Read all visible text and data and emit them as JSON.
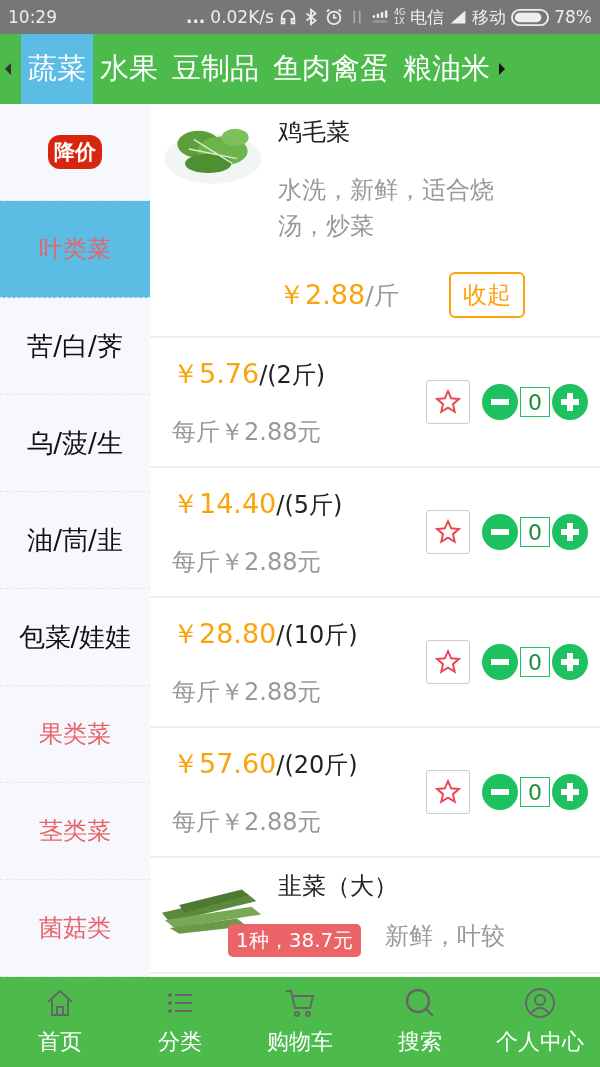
{
  "status_bar": {
    "time": "10:29",
    "dots": "...",
    "speed": "0.02K/s",
    "net_top": "4G",
    "net_bottom": "1X",
    "carrier_1": "电信",
    "carrier_2": "移动",
    "battery": "78%"
  },
  "category_tabs": [
    {
      "label": "蔬菜",
      "selected": true
    },
    {
      "label": "水果",
      "selected": false
    },
    {
      "label": "豆制品",
      "selected": false
    },
    {
      "label": "鱼肉禽蛋",
      "selected": false
    },
    {
      "label": "粮油米",
      "selected": false
    }
  ],
  "sidebar": {
    "items": [
      {
        "label": "降价",
        "kind": "badge",
        "selected": false
      },
      {
        "label": "叶类菜",
        "kind": "category",
        "selected": true
      },
      {
        "label": "苦/白/荠",
        "kind": "sub",
        "selected": false
      },
      {
        "label": "乌/菠/生",
        "kind": "sub",
        "selected": false
      },
      {
        "label": "油/茼/韭",
        "kind": "sub",
        "selected": false
      },
      {
        "label": "包菜/娃娃",
        "kind": "sub",
        "selected": false
      },
      {
        "label": "果类菜",
        "kind": "category",
        "selected": false
      },
      {
        "label": "茎类菜",
        "kind": "category",
        "selected": false
      },
      {
        "label": "菌菇类",
        "kind": "category",
        "selected": false
      }
    ]
  },
  "products": [
    {
      "name": "鸡毛菜",
      "kind": "picture",
      "description": "水洗，新鲜，适合烧汤，炒菜",
      "price": "￥2.88",
      "unit": "/斤",
      "toggle": "收起",
      "expanded": true,
      "variants": [
        {
          "price": "￥5.76",
          "pack": "/(2斤)",
          "per_unit": "每斤￥2.88元",
          "favorite": false,
          "quantity": "0"
        },
        {
          "price": "￥14.40",
          "pack": "/(5斤)",
          "per_unit": "每斤￥2.88元",
          "favorite": false,
          "quantity": "0"
        },
        {
          "price": "￥28.80",
          "pack": "/(10斤)",
          "per_unit": "每斤￥2.88元",
          "favorite": false,
          "quantity": "0"
        },
        {
          "price": "￥57.60",
          "pack": "/(20斤)",
          "per_unit": "每斤￥2.88元",
          "favorite": false,
          "quantity": "0"
        }
      ]
    },
    {
      "name": "韭菜（大）",
      "kind": "picture",
      "description": "新鲜，叶较"
    }
  ],
  "cart_badge": "1种，38.7元",
  "bottom_nav": [
    {
      "label": "首页"
    },
    {
      "label": "分类"
    },
    {
      "label": "购物车"
    },
    {
      "label": "搜索"
    },
    {
      "label": "个人中心"
    }
  ]
}
